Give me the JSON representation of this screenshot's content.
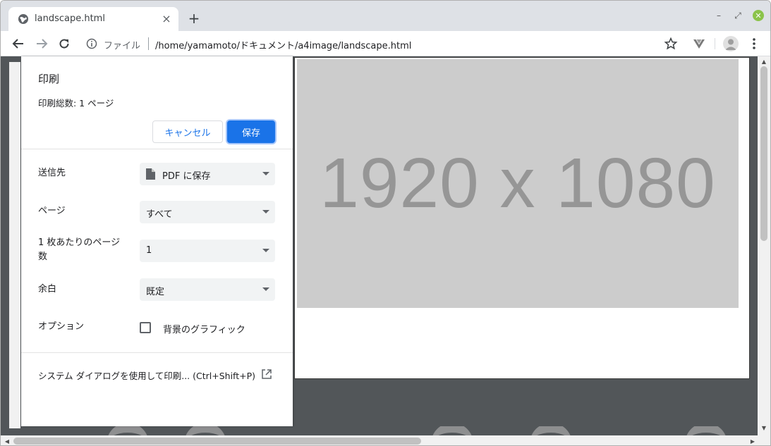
{
  "tab": {
    "title": "landscape.html",
    "favicon": "globe-icon",
    "close": "×"
  },
  "new_tab": "+",
  "window_controls": {
    "minimize": "–",
    "maximize": "⤢",
    "close": "✕"
  },
  "omnibox": {
    "scheme_label": "ファイル",
    "url": "/home/yamamoto/ドキュメント/a4image/landscape.html"
  },
  "preview": {
    "placeholder_text": "1920 x 1080"
  },
  "print_dialog": {
    "title": "印刷",
    "summary": "印刷総数: 1 ページ",
    "cancel_label": "キャンセル",
    "save_label": "保存",
    "destination": {
      "label": "送信先",
      "value": "PDF に保存"
    },
    "pages": {
      "label": "ページ",
      "value": "すべて"
    },
    "pages_per_sheet": {
      "label_line1": "1 枚あたりのページ",
      "label_line2": "数",
      "value": "1"
    },
    "margins": {
      "label": "余白",
      "value": "既定"
    },
    "options": {
      "label": "オプション",
      "checkbox_label": "背景のグラフィック",
      "checked": false
    },
    "system_dialog": "システム ダイアログを使用して印刷... (Ctrl+Shift+P)"
  },
  "colors": {
    "accent": "#1a73e8",
    "preview_bg": "#525659",
    "placeholder_bg": "#cccccc",
    "placeholder_text": "#969696"
  }
}
